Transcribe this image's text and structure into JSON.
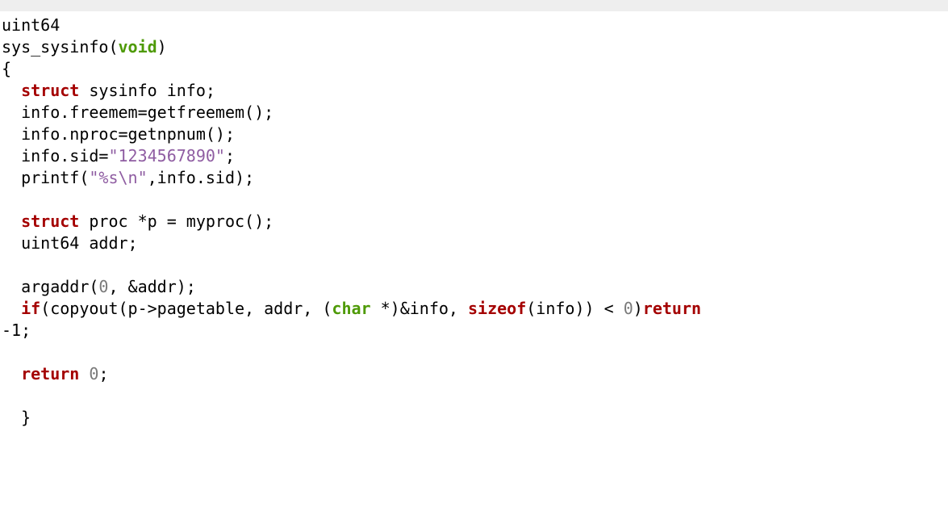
{
  "code": {
    "l1": "uint64",
    "l2a": "sys_sysinfo(",
    "l2_void": "void",
    "l2b": ")",
    "l3": "{",
    "l4_indent": "  ",
    "l4_struct": "struct",
    "l4_rest": " sysinfo info;",
    "l5": "  info.freemem=getfreemem();",
    "l6": "  info.nproc=getnpnum();",
    "l7a": "  info.sid=",
    "l7_str": "\"1234567890\"",
    "l7b": ";",
    "l8a": "  printf(",
    "l8_str": "\"%s\\n\"",
    "l8b": ",info.sid);",
    "blank1": "",
    "l10_indent": "  ",
    "l10_struct": "struct",
    "l10_rest": " proc *p = myproc();",
    "l11": "  uint64 addr;",
    "blank2": "",
    "l13a": "  argaddr(",
    "l13_zero": "0",
    "l13b": ", &addr);",
    "l14_indent": "  ",
    "l14_if": "if",
    "l14a": "(copyout(p->pagetable, addr, (",
    "l14_char": "char",
    "l14b": " *)&info, ",
    "l14_sizeof": "sizeof",
    "l14c": "(info)) < ",
    "l14_zero": "0",
    "l14d": ")",
    "l14_return": "return",
    "l14e": " ",
    "l15": "-1;",
    "blank3": "",
    "l17_indent": "  ",
    "l17_return": "return",
    "l17_sp": " ",
    "l17_zero": "0",
    "l17_semi": ";",
    "blank4": "",
    "l19": "  }"
  }
}
